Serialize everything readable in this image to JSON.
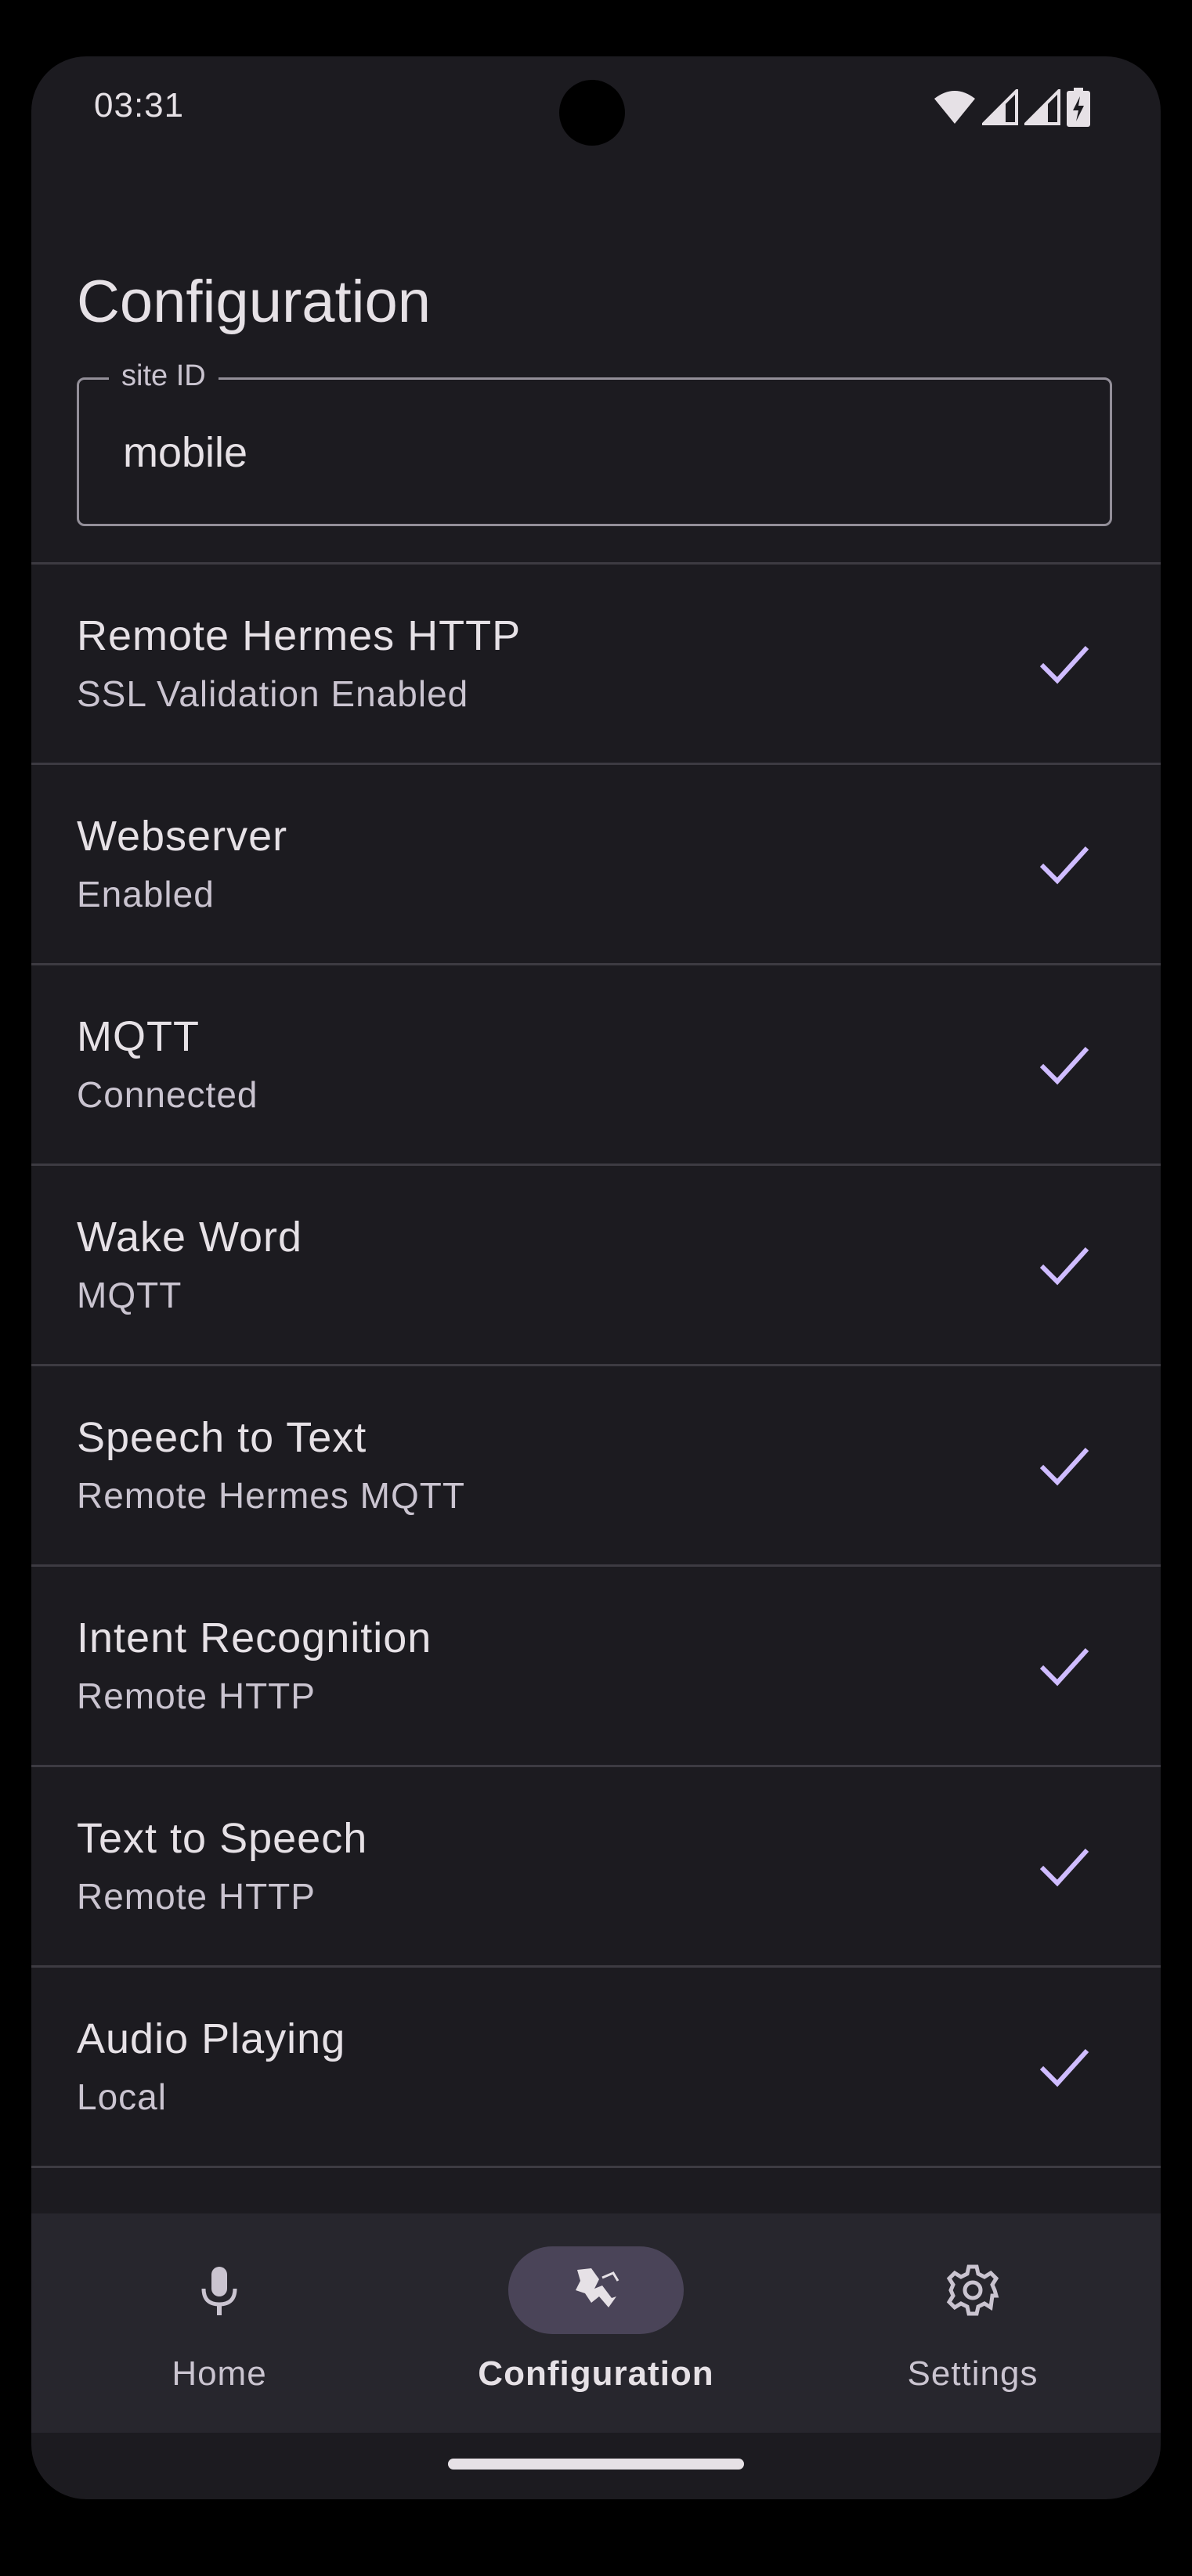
{
  "status_bar": {
    "time": "03:31",
    "icons": [
      "wifi-icon",
      "signal-icon",
      "signal-icon",
      "battery-charging-icon"
    ]
  },
  "page": {
    "title": "Configuration"
  },
  "site_field": {
    "label": "site ID",
    "value": "mobile"
  },
  "config_items": [
    {
      "title": "Remote Hermes HTTP",
      "subtitle": "SSL Validation Enabled",
      "status_icon": "check-icon"
    },
    {
      "title": "Webserver",
      "subtitle": "Enabled",
      "status_icon": "check-icon"
    },
    {
      "title": "MQTT",
      "subtitle": "Connected",
      "status_icon": "check-icon"
    },
    {
      "title": "Wake Word",
      "subtitle": "MQTT",
      "status_icon": "check-icon"
    },
    {
      "title": "Speech to Text",
      "subtitle": "Remote Hermes MQTT",
      "status_icon": "check-icon"
    },
    {
      "title": "Intent Recognition",
      "subtitle": "Remote HTTP",
      "status_icon": "check-icon"
    },
    {
      "title": "Text to Speech",
      "subtitle": "Remote HTTP",
      "status_icon": "check-icon"
    },
    {
      "title": "Audio Playing",
      "subtitle": "Local",
      "status_icon": "check-icon"
    }
  ],
  "bottom_nav": {
    "items": [
      {
        "label": "Home",
        "icon": "microphone-icon",
        "active": false
      },
      {
        "label": "Configuration",
        "icon": "configuration-icon",
        "active": true
      },
      {
        "label": "Settings",
        "icon": "gear-icon",
        "active": false
      }
    ]
  },
  "colors": {
    "background": "#1c1b20",
    "nav_background": "#27262d",
    "accent_check": "#cfbcff",
    "active_pill": "#4a4458",
    "text_primary": "#e6e1e6",
    "text_secondary": "#cac4d0"
  }
}
